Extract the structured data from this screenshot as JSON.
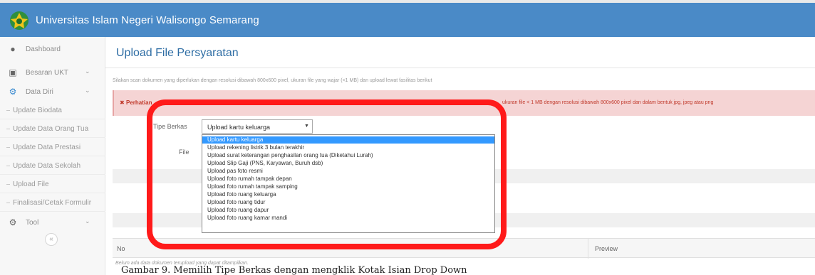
{
  "header": {
    "brand": "Universitas Islam Negeri Walisongo Semarang",
    "logo_icon": "university-seal-icon"
  },
  "sidebar": {
    "items": [
      {
        "label": "Dashboard",
        "icon": "dashboard-icon"
      },
      {
        "label": "Besaran UKT",
        "icon": "card-icon"
      },
      {
        "label": "Data Diri",
        "icon": "user-icon"
      }
    ],
    "subitems": [
      {
        "label": "Update Biodata"
      },
      {
        "label": "Update Data Orang Tua"
      },
      {
        "label": "Update Data Prestasi"
      },
      {
        "label": "Update Data Sekolah"
      },
      {
        "label": "Upload File"
      },
      {
        "label": "Finalisasi/Cetak Formulir"
      }
    ],
    "tool": {
      "label": "Tool",
      "icon": "gears-icon"
    },
    "collapse_icon": "collapse-icon"
  },
  "main": {
    "title": "Upload File Persyaratan",
    "instruction": "Silakan scan dokumen yang diperlukan dengan resolusi dibawah 800x600 pixel, ukuran file yang wajar (<1 MB) dan upload lewat fasilitas berikut",
    "alert": {
      "label": "Perhatian",
      "text": "ukuran file < 1 MB dengan resolusi dibawah 800x600 pixel dan dalam bentuk jpg, jpeg atau png"
    },
    "form": {
      "tipe_label": "Tipe Berkas",
      "file_label": "File",
      "selected": "Upload kartu keluarga",
      "options": [
        "Upload kartu keluarga",
        "Upload rekening listrik 3 bulan terakhir",
        "Upload surat keterangan penghasilan orang tua (Diketahui Lurah)",
        "Upload Slip Gaji (PNS, Karyawan, Buruh dsb)",
        "Upload pas foto resmi",
        "Upload foto rumah tampak depan",
        "Upload foto rumah tampak samping",
        "Upload foto ruang keluarga",
        "Upload foto ruang tidur",
        "Upload foto ruang dapur",
        "Upload foto ruang kamar mandi"
      ]
    },
    "table": {
      "col_no": "No",
      "col_preview": "Preview",
      "empty": "Belum ada data dokumen terupload yang dapat ditampilkan."
    }
  },
  "caption": "Gambar 9. Memilih Tipe Berkas dengan mengklik Kotak Isian Drop Down",
  "colors": {
    "header": "#4a8ac7",
    "highlight": "#3399ff",
    "annotation": "#ff1a1a",
    "alert_bg": "#f5d4d4"
  }
}
